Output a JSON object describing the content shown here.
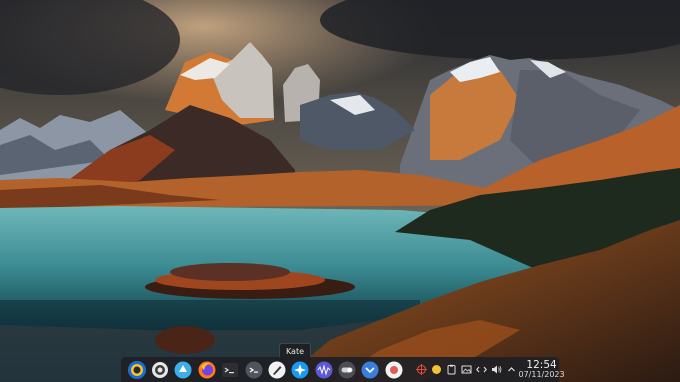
{
  "wallpaper": {
    "description_icon": "mountain-lake-wallpaper"
  },
  "tooltip": {
    "text": "Kate"
  },
  "taskbar": {
    "launchers": [
      {
        "name": "app-launcher-icon"
      },
      {
        "name": "system-settings-icon"
      },
      {
        "name": "discover-icon"
      },
      {
        "name": "firefox-icon"
      },
      {
        "name": "terminal-icon"
      },
      {
        "name": "konsole-icon"
      },
      {
        "name": "kate-icon"
      },
      {
        "name": "kdenlive-icon"
      },
      {
        "name": "audio-editor-icon"
      },
      {
        "name": "toggle-switch-icon"
      },
      {
        "name": "chevron-app-icon"
      },
      {
        "name": "cursor-app-icon"
      }
    ],
    "tray": [
      {
        "name": "screenshot-crosshair-icon"
      },
      {
        "name": "status-dot-icon"
      },
      {
        "name": "clipboard-icon"
      },
      {
        "name": "image-viewer-icon"
      },
      {
        "name": "kde-connect-icon"
      },
      {
        "name": "volume-icon"
      },
      {
        "name": "tray-expand-icon"
      }
    ],
    "clock": {
      "time": "12:54",
      "date": "07/11/2023"
    }
  }
}
